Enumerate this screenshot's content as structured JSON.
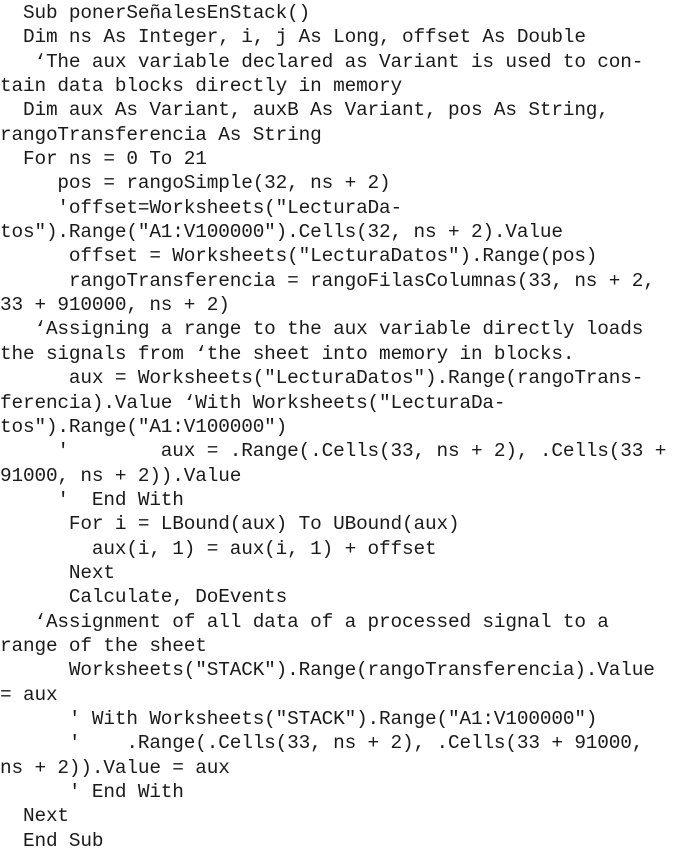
{
  "document": {
    "kind": "code-listing",
    "language": "VBA",
    "procedure_name": "ponerSeñalesEnStack",
    "text_color": "#1a1a1a",
    "background_color": "#ffffff",
    "lines": [
      "  Sub ponerSeñalesEnStack()",
      "  Dim ns As Integer, i, j As Long, offset As Double",
      "   ‘The aux variable declared as Variant is used to con-",
      "tain data blocks directly in memory",
      "  Dim aux As Variant, auxB As Variant, pos As String,",
      "rangoTransferencia As String",
      "  For ns = 0 To 21",
      "     pos = rangoSimple(32, ns + 2)",
      "     'offset=Worksheets(\"LecturaDa-",
      "tos\").Range(\"A1:V100000\").Cells(32, ns + 2).Value",
      "      offset = Worksheets(\"LecturaDatos\").Range(pos)",
      "      rangoTransferencia = rangoFilasColumnas(33, ns + 2,",
      "33 + 910000, ns + 2)",
      "   ‘Assigning a range to the aux variable directly loads",
      "the signals from ‘the sheet into memory in blocks.",
      "      aux = Worksheets(\"LecturaDatos\").Range(rangoTrans-",
      "ferencia).Value ‘With Worksheets(\"LecturaDa-",
      "tos\").Range(\"A1:V100000\")",
      "     '        aux = .Range(.Cells(33, ns + 2), .Cells(33 +",
      "91000, ns + 2)).Value",
      "     '  End With",
      "      For i = LBound(aux) To UBound(aux)",
      "        aux(i, 1) = aux(i, 1) + offset",
      "      Next",
      "      Calculate, DoEvents",
      "   ‘Assignment of all data of a processed signal to a",
      "range of the sheet",
      "      Worksheets(\"STACK\").Range(rangoTransferencia).Value",
      "= aux",
      "      ' With Worksheets(\"STACK\").Range(\"A1:V100000\")",
      "      '    .Range(.Cells(33, ns + 2), .Cells(33 + 91000,",
      "ns + 2)).Value = aux",
      "      ' End With",
      "  Next",
      "  End Sub"
    ]
  }
}
